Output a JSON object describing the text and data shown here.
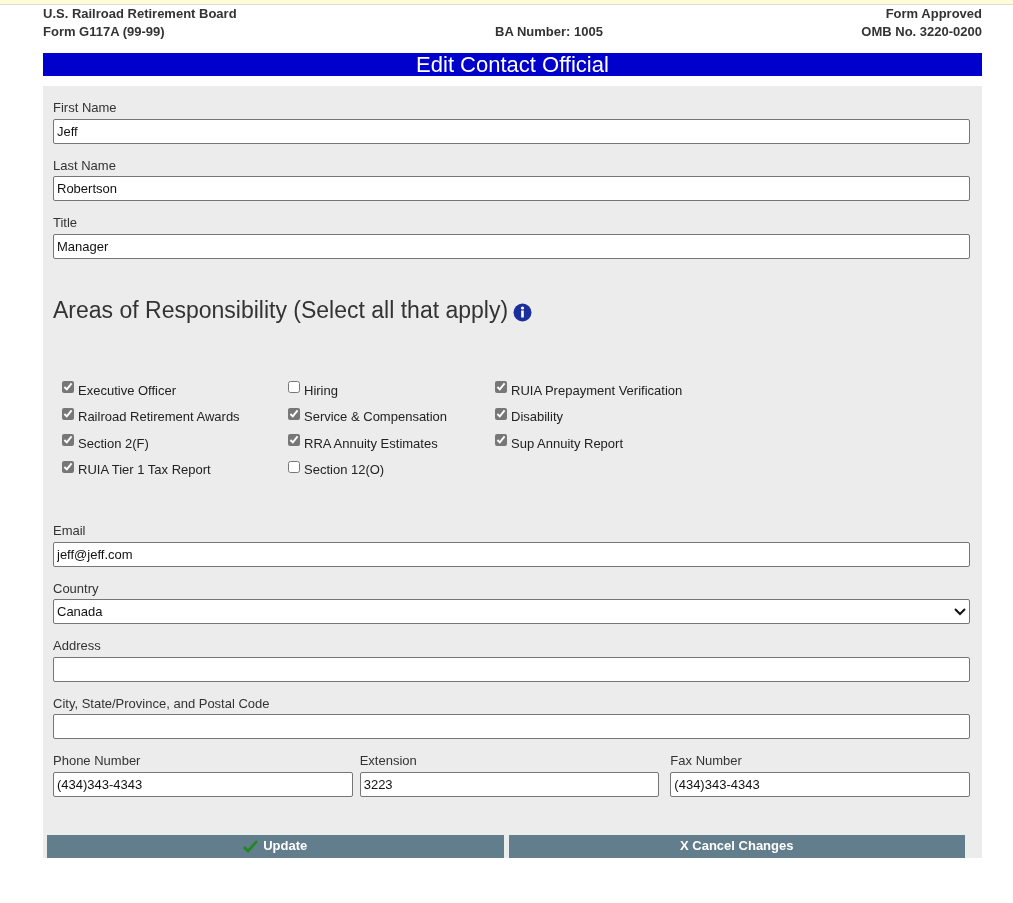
{
  "header": {
    "agency": "U.S. Railroad Retirement Board",
    "form_number": "Form G117A (99-99)",
    "ba_number": "BA Number: 1005",
    "approval": "Form Approved",
    "omb": "OMB No. 3220-0200"
  },
  "title": "Edit Contact Official",
  "name_fields": [
    {
      "label": "First Name",
      "value": "Jeff"
    },
    {
      "label": "Last Name",
      "value": "Robertson"
    },
    {
      "label": "Title",
      "value": "Manager"
    }
  ],
  "responsibilities": {
    "heading": "Areas of Responsibility (Select all that apply)",
    "columns": [
      [
        {
          "label": "Executive Officer",
          "checked": true
        },
        {
          "label": "Railroad Retirement Awards",
          "checked": true
        },
        {
          "label": "Section 2(F)",
          "checked": true
        },
        {
          "label": "RUIA Tier 1 Tax Report",
          "checked": true
        }
      ],
      [
        {
          "label": "Hiring",
          "checked": false
        },
        {
          "label": "Service & Compensation",
          "checked": true
        },
        {
          "label": "RRA Annuity Estimates",
          "checked": true
        },
        {
          "label": "Section 12(O)",
          "checked": false
        }
      ],
      [
        {
          "label": "RUIA Prepayment Verification",
          "checked": true
        },
        {
          "label": "Disability",
          "checked": true
        },
        {
          "label": "Sup Annuity Report",
          "checked": true
        }
      ]
    ]
  },
  "contact_fields": [
    {
      "label": "Email",
      "value": "jeff@jeff.com",
      "kind": "text"
    },
    {
      "label": "Country",
      "value": "Canada",
      "kind": "select"
    },
    {
      "label": "Address",
      "kind": "text"
    },
    {
      "label": "City, State/Province, and Postal Code",
      "kind": "text"
    }
  ],
  "phone_fields": [
    {
      "label": "Phone Number",
      "value": "(434)343-4343"
    },
    {
      "label": "Extension",
      "value": "3223"
    },
    {
      "label": "Fax Number",
      "value": "(434)343-4343"
    }
  ],
  "buttons": [
    {
      "label": "Update",
      "kind": "update"
    },
    {
      "label": "X Cancel Changes",
      "kind": "cancel"
    }
  ]
}
